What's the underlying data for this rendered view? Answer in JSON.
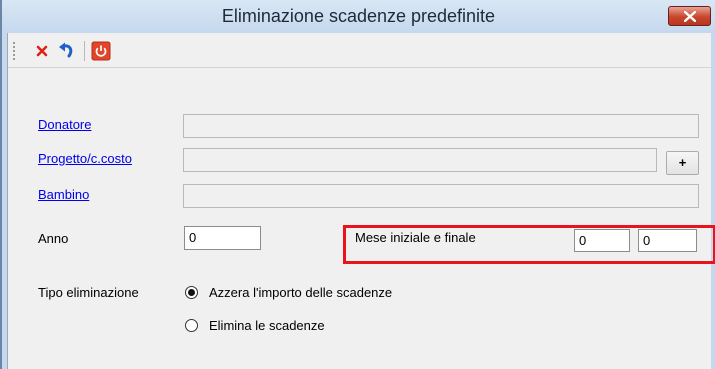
{
  "window": {
    "title": "Eliminazione scadenze predefinite"
  },
  "toolbar": {
    "buttons": [
      {
        "name": "delete",
        "icon": "red-x-icon",
        "color": "#e0201a"
      },
      {
        "name": "undo",
        "icon": "undo-arrow-icon",
        "color": "#1f5fc9"
      },
      {
        "name": "exit",
        "icon": "power-icon",
        "color": "#e2452a"
      }
    ]
  },
  "form": {
    "donatore_label": "Donatore",
    "progetto_label": "Progetto/c.costo",
    "progetto_button": "+",
    "bambino_label": "Bambino",
    "anno_label": "Anno",
    "anno_value": "0",
    "mese_label": "Mese iniziale e finale",
    "mese_iniziale_value": "0",
    "mese_finale_value": "0",
    "tipo_label": "Tipo eliminazione",
    "options": [
      {
        "label": "Azzera l'importo delle scadenze",
        "selected": true
      },
      {
        "label": "Elimina le scadenze",
        "selected": false
      }
    ]
  },
  "highlight_color": "#e8131b"
}
